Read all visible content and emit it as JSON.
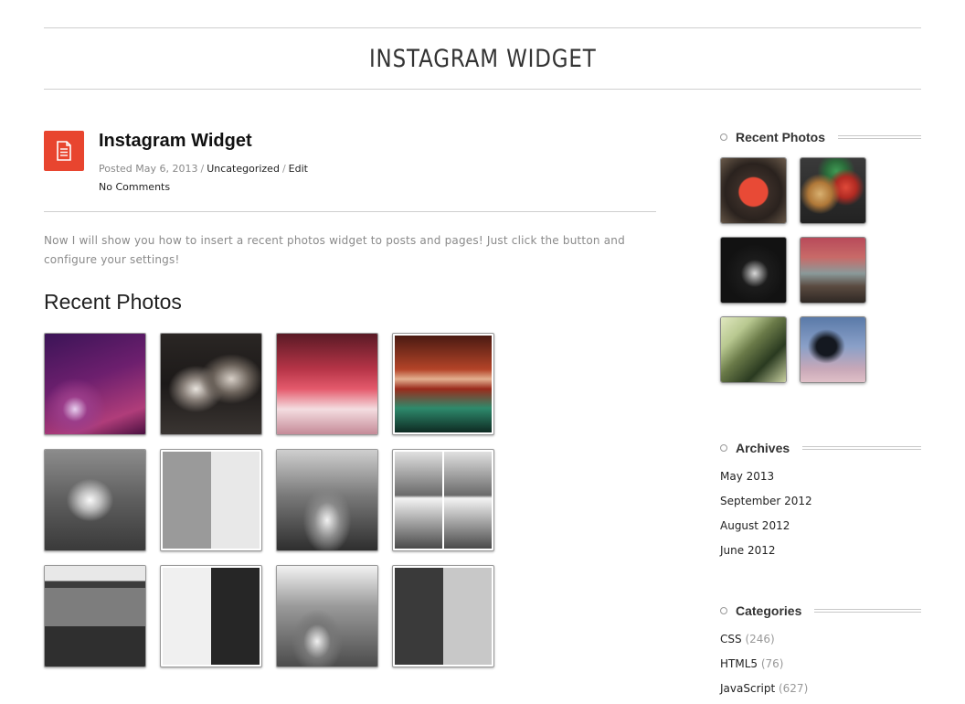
{
  "header": {
    "title": "INSTAGRAM WIDGET"
  },
  "post": {
    "icon": "document-icon",
    "title": "Instagram Widget",
    "posted_label": "Posted May 6, 2013",
    "separator": "/",
    "category": "Uncategorized",
    "edit": "Edit",
    "comments": "No Comments",
    "body": "Now I will show you how to insert a recent photos widget to posts and pages! Just click the button and configure your settings!",
    "section_heading": "Recent Photos"
  },
  "sidebar": {
    "recent_photos": {
      "title": "Recent Photos"
    },
    "archives": {
      "title": "Archives",
      "items": [
        "May 2013",
        "September 2012",
        "August 2012",
        "June 2012"
      ]
    },
    "categories": {
      "title": "Categories",
      "items": [
        {
          "name": "CSS",
          "count": "(246)"
        },
        {
          "name": "HTML5",
          "count": "(76)"
        },
        {
          "name": "JavaScript",
          "count": "(627)"
        }
      ]
    }
  },
  "colors": {
    "accent": "#e8452f",
    "text": "#333333",
    "muted": "#8a8a8a",
    "rule": "#cfcfcf"
  }
}
